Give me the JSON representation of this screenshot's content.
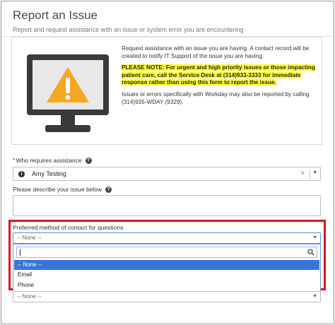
{
  "header": {
    "title": "Report an Issue",
    "subtitle": "Report and request assistance with an issue or system error you are encountering"
  },
  "info": {
    "para1": "Request assistance with an issue you are having. A contact record will be created to notify IT Support of the issue you are having.",
    "note": "PLEASE NOTE: For urgent and high priority issues or those impacting patient care, call the Service Desk at (314)933-3333 for immediate response rather than using this form to report the issue.",
    "para3": "Issues or errors specifically with Workday may also be reported by calling (314)935-WDAY (9329)."
  },
  "form": {
    "who_required_mark": "*",
    "who_label": "Who requires assistance",
    "who_value": "Amy Testing",
    "clear_glyph": "×",
    "dropdown_glyph": "▼",
    "help_glyph": "?",
    "info_glyph": "i",
    "describe_label": "Please describe your issue below",
    "contact_label": "Preferred method of contact for questions",
    "contact_value": "-- None --",
    "options": [
      "-- None --",
      "Email",
      "Phone"
    ],
    "selected_index": 0,
    "bottom_select_value": "-- None --"
  },
  "colors": {
    "highlight": "#ffff33",
    "callout_border": "#d9161c",
    "selected_option": "#3875d7",
    "warning": "#f5a623"
  }
}
